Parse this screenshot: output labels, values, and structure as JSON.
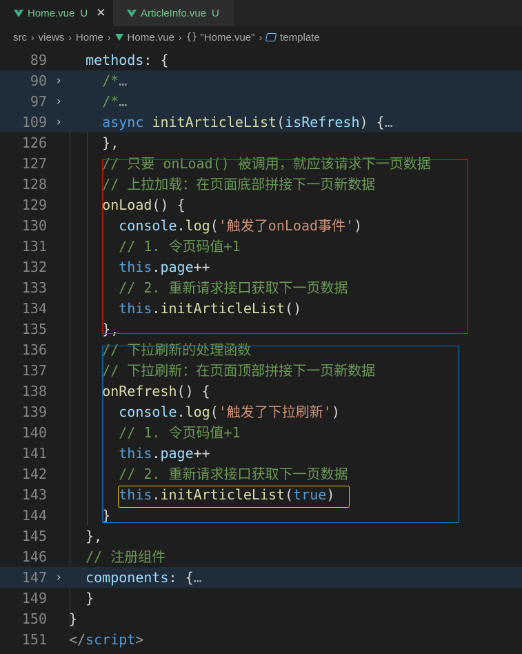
{
  "tabs": [
    {
      "name": "Home.vue",
      "status": "U",
      "close": "✕"
    },
    {
      "name": "ArticleInfo.vue",
      "status": "U"
    }
  ],
  "breadcrumb": {
    "items": [
      "src",
      "views",
      "Home",
      "Home.vue",
      "\"Home.vue\"",
      "template"
    ],
    "separator": "›",
    "braces": "{}"
  },
  "lines": [
    {
      "num": "89",
      "fold": "",
      "tokens": [
        {
          "t": "  "
        },
        {
          "t": "methods",
          "c": "p"
        },
        {
          "t": ": {",
          "c": "d"
        }
      ]
    },
    {
      "num": "90",
      "fold": "›",
      "hl": true,
      "tokens": [
        {
          "t": "    "
        },
        {
          "t": "/*",
          "c": "c"
        },
        {
          "t": "…",
          "c": "ell"
        }
      ]
    },
    {
      "num": "97",
      "fold": "›",
      "hl": true,
      "tokens": [
        {
          "t": "    "
        },
        {
          "t": "/*",
          "c": "c"
        },
        {
          "t": "…",
          "c": "ell"
        }
      ]
    },
    {
      "num": "109",
      "fold": "›",
      "hl": true,
      "tokens": [
        {
          "t": "    "
        },
        {
          "t": "async",
          "c": "k"
        },
        {
          "t": " "
        },
        {
          "t": "initArticleList",
          "c": "f"
        },
        {
          "t": "(",
          "c": "d"
        },
        {
          "t": "isRefresh",
          "c": "p"
        },
        {
          "t": ") {",
          "c": "d"
        },
        {
          "t": "…",
          "c": "ell"
        }
      ]
    },
    {
      "num": "126",
      "fold": "",
      "tokens": [
        {
          "t": "    "
        },
        {
          "t": "},",
          "c": "d"
        }
      ]
    },
    {
      "num": "127",
      "fold": "",
      "tokens": [
        {
          "t": "    "
        },
        {
          "t": "// 只要 onLoad() 被调用，就应该请求下一页数据",
          "c": "c"
        }
      ]
    },
    {
      "num": "128",
      "fold": "",
      "tokens": [
        {
          "t": "    "
        },
        {
          "t": "// 上拉加载：在页面底部拼接下一页新数据",
          "c": "c"
        }
      ]
    },
    {
      "num": "129",
      "fold": "",
      "tokens": [
        {
          "t": "    "
        },
        {
          "t": "onLoad",
          "c": "f"
        },
        {
          "t": "() {",
          "c": "d"
        }
      ]
    },
    {
      "num": "130",
      "fold": "",
      "tokens": [
        {
          "t": "      "
        },
        {
          "t": "console",
          "c": "p"
        },
        {
          "t": ".",
          "c": "d"
        },
        {
          "t": "log",
          "c": "f"
        },
        {
          "t": "(",
          "c": "d"
        },
        {
          "t": "'触发了onLoad事件'",
          "c": "s"
        },
        {
          "t": ")",
          "c": "d"
        }
      ]
    },
    {
      "num": "131",
      "fold": "",
      "tokens": [
        {
          "t": "      "
        },
        {
          "t": "// 1. 令页码值+1",
          "c": "c"
        }
      ]
    },
    {
      "num": "132",
      "fold": "",
      "tokens": [
        {
          "t": "      "
        },
        {
          "t": "this",
          "c": "k"
        },
        {
          "t": ".",
          "c": "d"
        },
        {
          "t": "page",
          "c": "p"
        },
        {
          "t": "++",
          "c": "d"
        }
      ]
    },
    {
      "num": "133",
      "fold": "",
      "tokens": [
        {
          "t": "      "
        },
        {
          "t": "// 2. 重新请求接口获取下一页数据",
          "c": "c"
        }
      ]
    },
    {
      "num": "134",
      "fold": "",
      "tokens": [
        {
          "t": "      "
        },
        {
          "t": "this",
          "c": "k"
        },
        {
          "t": ".",
          "c": "d"
        },
        {
          "t": "initArticleList",
          "c": "f"
        },
        {
          "t": "()",
          "c": "d"
        }
      ]
    },
    {
      "num": "135",
      "fold": "",
      "tokens": [
        {
          "t": "    "
        },
        {
          "t": "},",
          "c": "d"
        }
      ]
    },
    {
      "num": "136",
      "fold": "",
      "tokens": [
        {
          "t": "    "
        },
        {
          "t": "// 下拉刷新的处理函数",
          "c": "c"
        }
      ]
    },
    {
      "num": "137",
      "fold": "",
      "tokens": [
        {
          "t": "    "
        },
        {
          "t": "// 下拉刷新：在页面顶部拼接下一页新数据",
          "c": "c"
        }
      ]
    },
    {
      "num": "138",
      "fold": "",
      "tokens": [
        {
          "t": "    "
        },
        {
          "t": "onRefresh",
          "c": "f"
        },
        {
          "t": "() {",
          "c": "d"
        }
      ]
    },
    {
      "num": "139",
      "fold": "",
      "tokens": [
        {
          "t": "      "
        },
        {
          "t": "console",
          "c": "p"
        },
        {
          "t": ".",
          "c": "d"
        },
        {
          "t": "log",
          "c": "f"
        },
        {
          "t": "(",
          "c": "d"
        },
        {
          "t": "'触发了下拉刷新'",
          "c": "s"
        },
        {
          "t": ")",
          "c": "d"
        }
      ]
    },
    {
      "num": "140",
      "fold": "",
      "tokens": [
        {
          "t": "      "
        },
        {
          "t": "// 1. 令页码值+1",
          "c": "c"
        }
      ]
    },
    {
      "num": "141",
      "fold": "",
      "tokens": [
        {
          "t": "      "
        },
        {
          "t": "this",
          "c": "k"
        },
        {
          "t": ".",
          "c": "d"
        },
        {
          "t": "page",
          "c": "p"
        },
        {
          "t": "++",
          "c": "d"
        }
      ]
    },
    {
      "num": "142",
      "fold": "",
      "tokens": [
        {
          "t": "      "
        },
        {
          "t": "// 2. 重新请求接口获取下一页数据",
          "c": "c"
        }
      ]
    },
    {
      "num": "143",
      "fold": "",
      "tokens": [
        {
          "t": "      "
        },
        {
          "t": "this",
          "c": "k"
        },
        {
          "t": ".",
          "c": "d"
        },
        {
          "t": "initArticleList",
          "c": "f"
        },
        {
          "t": "(",
          "c": "d"
        },
        {
          "t": "true",
          "c": "k"
        },
        {
          "t": ")",
          "c": "d"
        }
      ]
    },
    {
      "num": "144",
      "fold": "",
      "tokens": [
        {
          "t": "    "
        },
        {
          "t": "}",
          "c": "d"
        }
      ]
    },
    {
      "num": "145",
      "fold": "",
      "tokens": [
        {
          "t": "  "
        },
        {
          "t": "},",
          "c": "d"
        }
      ]
    },
    {
      "num": "146",
      "fold": "",
      "tokens": [
        {
          "t": "  "
        },
        {
          "t": "// 注册组件",
          "c": "c"
        }
      ]
    },
    {
      "num": "147",
      "fold": "›",
      "hl": true,
      "tokens": [
        {
          "t": "  "
        },
        {
          "t": "components",
          "c": "p"
        },
        {
          "t": ": {",
          "c": "d"
        },
        {
          "t": "…",
          "c": "ell"
        }
      ]
    },
    {
      "num": "149",
      "fold": "",
      "tokens": [
        {
          "t": "  "
        },
        {
          "t": "}",
          "c": "d"
        }
      ]
    },
    {
      "num": "150",
      "fold": "",
      "tokens": [
        {
          "t": "}",
          "c": "d"
        }
      ]
    },
    {
      "num": "151",
      "fold": "",
      "tokens": [
        {
          "t": "</",
          "c": "ell"
        },
        {
          "t": "script",
          "c": "tag"
        },
        {
          "t": ">",
          "c": "ell"
        }
      ]
    }
  ],
  "colors": {
    "onload_box": "#e51400",
    "onrefresh_box": "#007acc",
    "call_box": "#ffc107"
  }
}
